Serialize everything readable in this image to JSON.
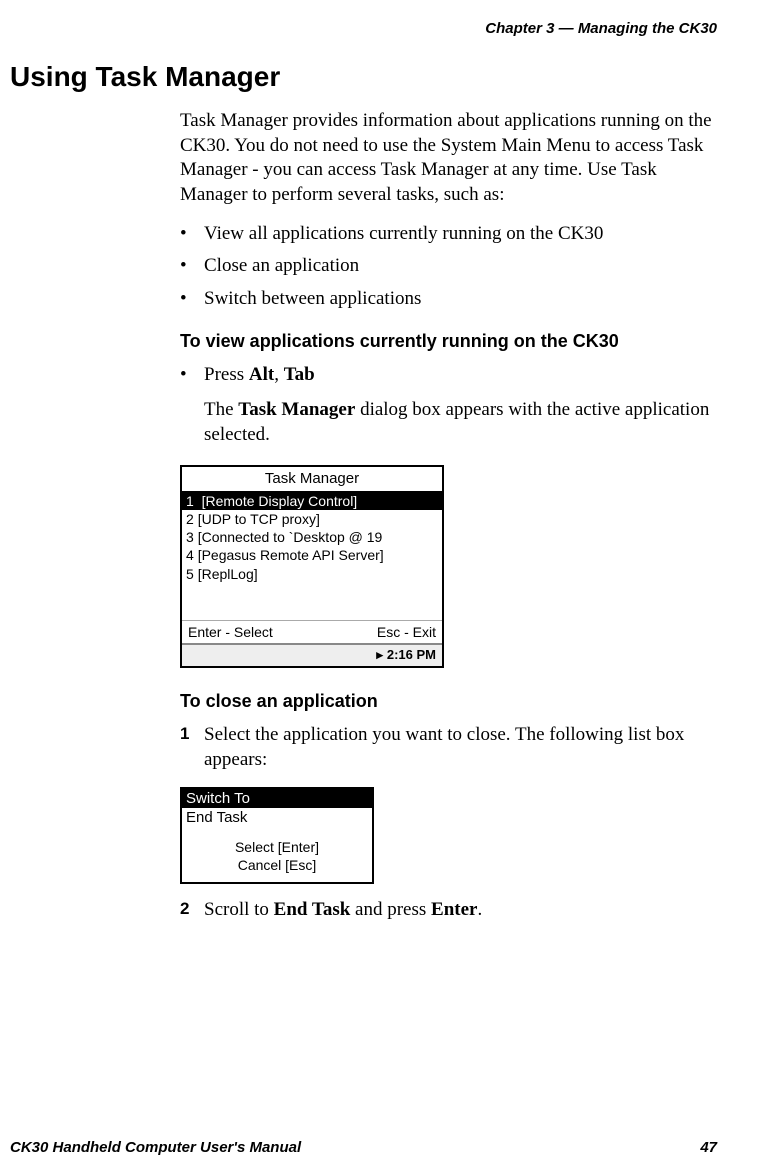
{
  "header": {
    "running_head": "Chapter 3 — Managing the CK30"
  },
  "section": {
    "title": "Using Task Manager",
    "intro": "Task Manager provides information about applications running on the CK30. You do not need to use the System Main Menu to access Task Manager - you can access Task Manager at any time. Use Task Manager to perform several tasks, such as:",
    "bullets": [
      "View all applications currently running on the CK30",
      "Close an application",
      "Switch between applications"
    ]
  },
  "view_apps": {
    "heading": "To view applications currently running on the CK30",
    "step_prefix": "Press ",
    "key1": "Alt",
    "sep": ", ",
    "key2": "Tab",
    "result_a": "The ",
    "result_b": "Task Manager",
    "result_c": " dialog box appears with the active application selected."
  },
  "tm": {
    "title": "Task Manager",
    "rows": [
      {
        "n": "1",
        "label": "[Remote Display Control]",
        "selected": true
      },
      {
        "n": "2",
        "label": "[UDP to TCP proxy]",
        "selected": false
      },
      {
        "n": "3",
        "label": "[Connected to `Desktop @ 19",
        "selected": false
      },
      {
        "n": "4",
        "label": "[Pegasus Remote API Server]",
        "selected": false
      },
      {
        "n": "5",
        "label": "[ReplLog]",
        "selected": false
      }
    ],
    "help_left": "Enter - Select",
    "help_right": "Esc - Exit",
    "status_time": "2:16 PM"
  },
  "close_app": {
    "heading": "To close an application",
    "step1": "Select the application you want to close. The following list box appears:",
    "ctx": {
      "rows": [
        {
          "label": "Switch To",
          "selected": true
        },
        {
          "label": "End Task",
          "selected": false
        }
      ],
      "help1": "Select [Enter]",
      "help2": "Cancel [Esc]"
    },
    "step2_a": "Scroll to ",
    "step2_b": "End Task",
    "step2_c": " and press ",
    "step2_d": "Enter",
    "step2_e": "."
  },
  "footer": {
    "left": "CK30 Handheld Computer User's Manual",
    "right": "47"
  }
}
